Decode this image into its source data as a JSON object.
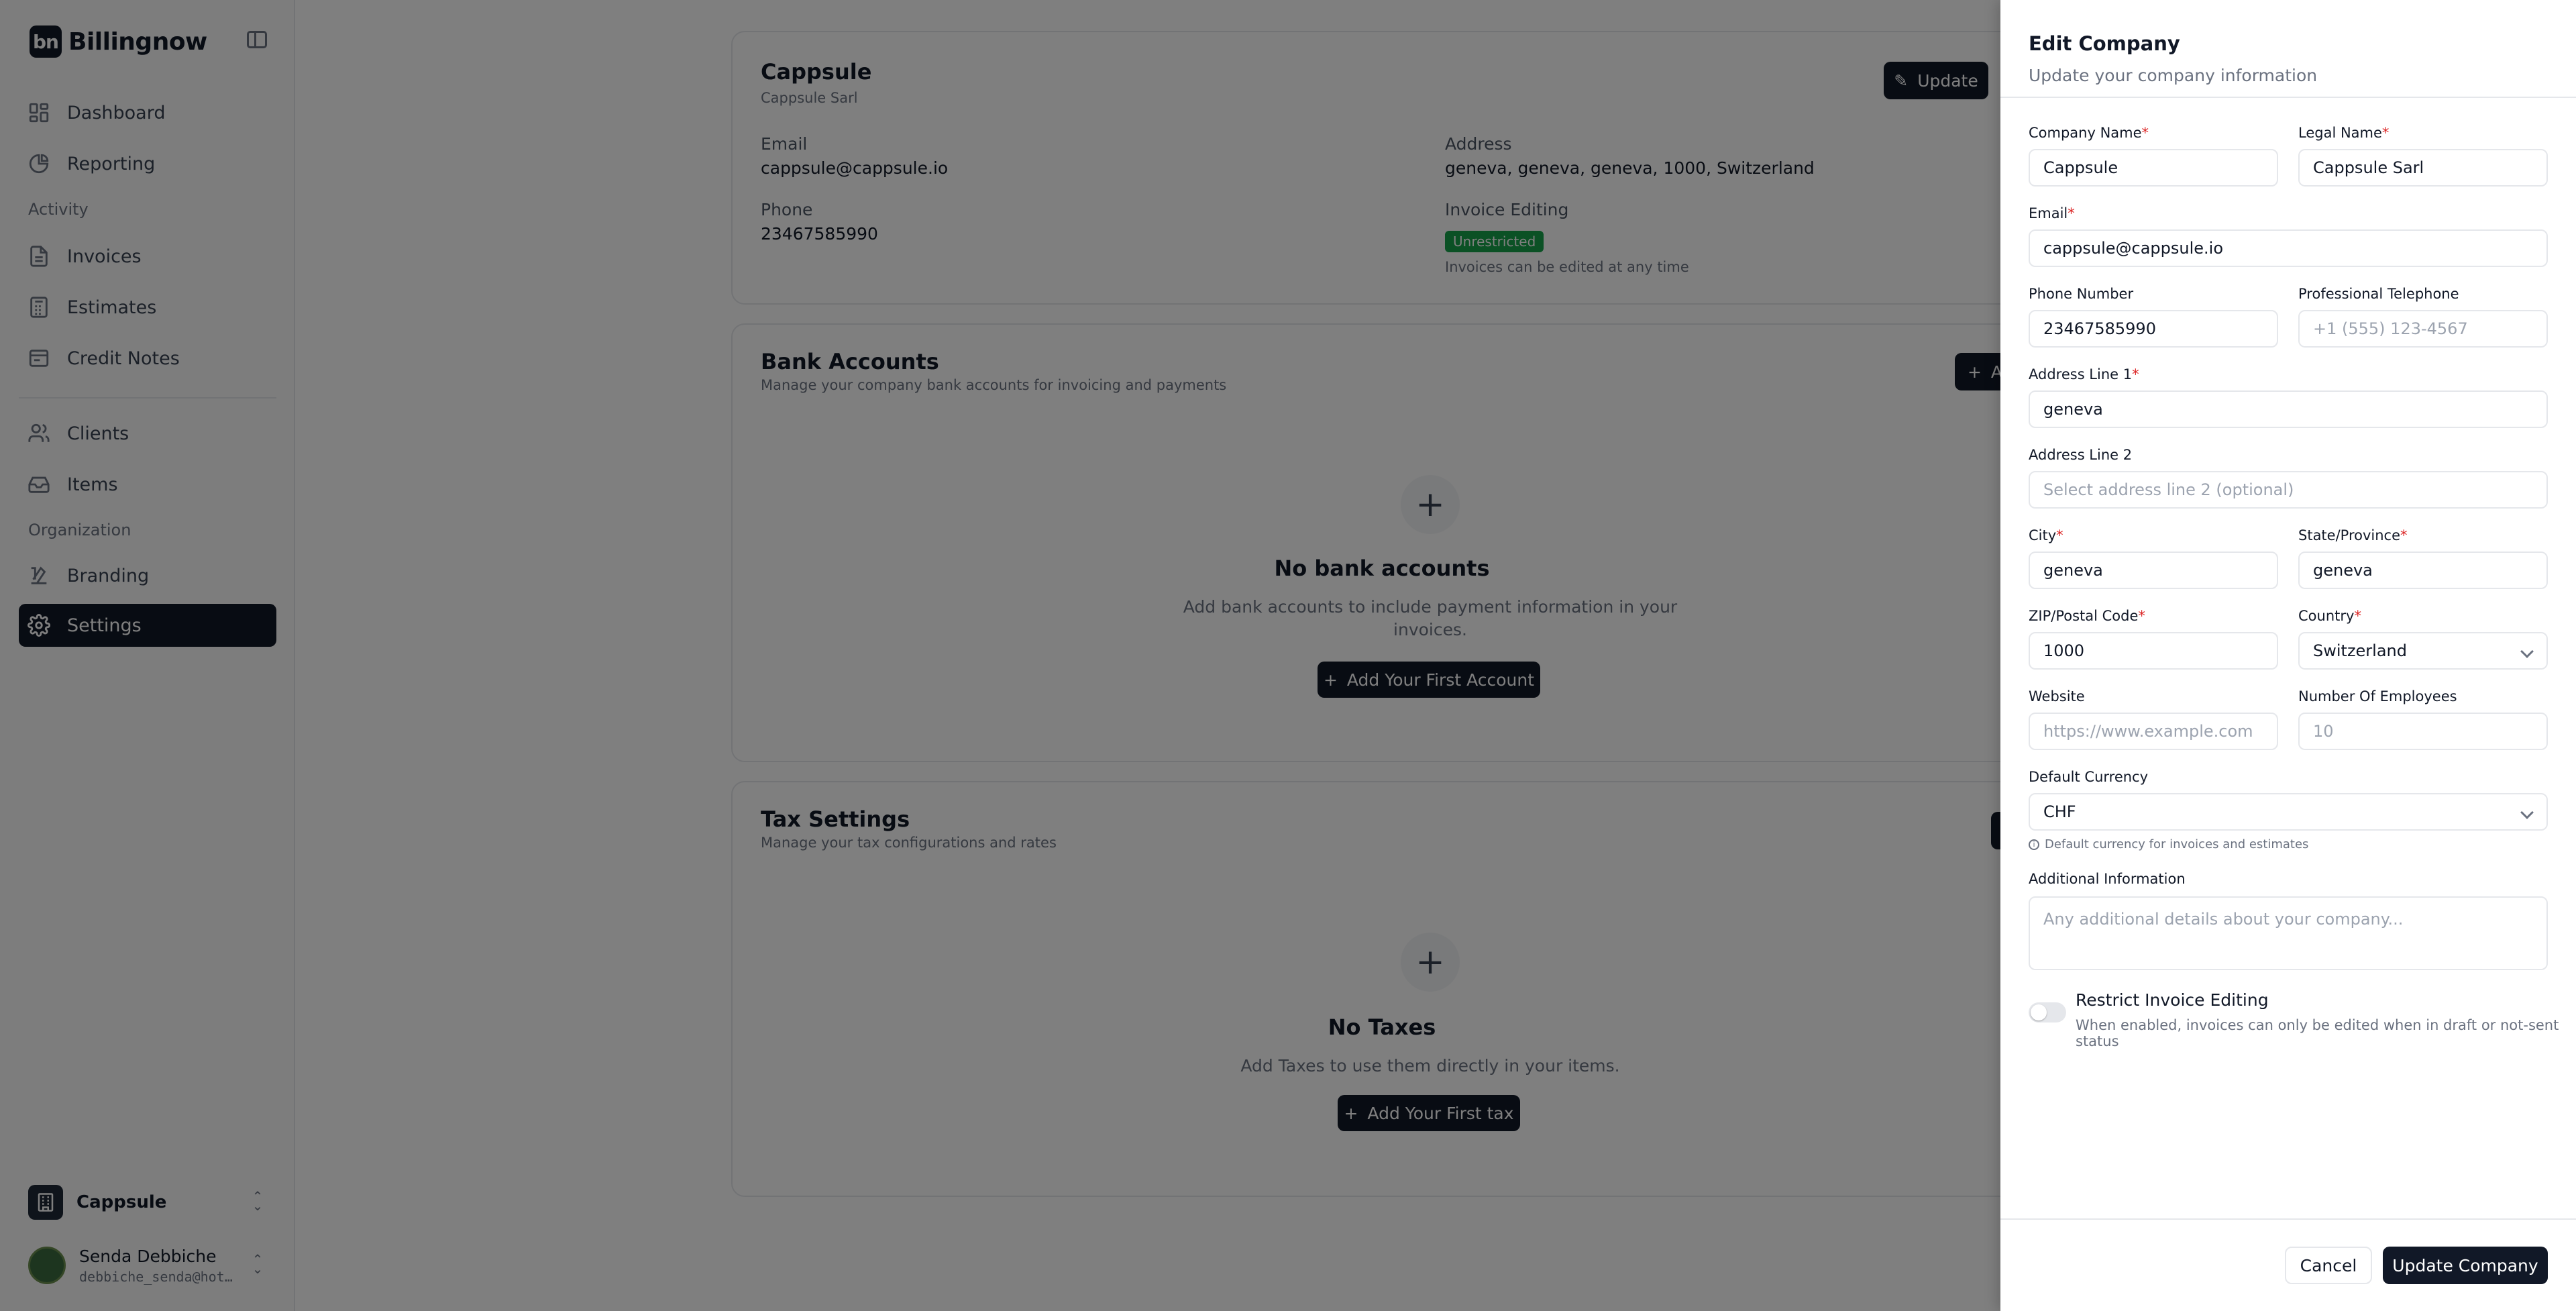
{
  "brand": {
    "name": "Billingnow",
    "mark": "bn"
  },
  "sidebar": {
    "items": [
      {
        "label": "Dashboard",
        "icon": "dashboard-icon"
      },
      {
        "label": "Reporting",
        "icon": "pie-chart-icon"
      },
      {
        "label": "Invoices",
        "icon": "file-icon"
      },
      {
        "label": "Estimates",
        "icon": "calculator-icon"
      },
      {
        "label": "Credit Notes",
        "icon": "receipt-icon"
      },
      {
        "label": "Clients",
        "icon": "users-icon"
      },
      {
        "label": "Items",
        "icon": "inbox-icon"
      },
      {
        "label": "Branding",
        "icon": "palette-icon"
      },
      {
        "label": "Settings",
        "icon": "gear-icon"
      }
    ],
    "sections": {
      "activity": "Activity",
      "organization": "Organization"
    },
    "org": {
      "name": "Cappsule"
    },
    "user": {
      "name": "Senda Debbiche",
      "email": "debbiche_senda@hot…"
    }
  },
  "company_card": {
    "title": "Cappsule",
    "subtitle": "Cappsule Sarl",
    "update_label": "Update",
    "email_label": "Email",
    "email_value": "cappsule@cappsule.io",
    "phone_label": "Phone",
    "phone_value": "23467585990",
    "address_label": "Address",
    "address_value": "geneva, geneva, geneva, 1000, Switzerland",
    "invoice_label": "Invoice Editing",
    "invoice_badge": "Unrestricted",
    "invoice_note": "Invoices can be edited at any time"
  },
  "bank_card": {
    "title": "Bank Accounts",
    "subtitle": "Manage your company bank accounts for invoicing and payments",
    "add_label": "A",
    "empty_title": "No bank accounts",
    "empty_desc_1": "Add bank accounts to include payment information in your",
    "empty_desc_2": "invoices.",
    "cta": "Add Your First Account"
  },
  "tax_card": {
    "title": "Tax Settings",
    "subtitle": "Manage your tax configurations and rates",
    "empty_title": "No Taxes",
    "empty_desc": "Add Taxes to use them directly in your items.",
    "cta": "Add Your First tax"
  },
  "drawer": {
    "title": "Edit Company",
    "subtitle": "Update your company information",
    "company_name": {
      "label": "Company Name",
      "value": "Cappsule"
    },
    "legal_name": {
      "label": "Legal Name",
      "value": "Cappsule Sarl"
    },
    "email": {
      "label": "Email",
      "value": "cappsule@cappsule.io"
    },
    "phone": {
      "label": "Phone Number",
      "value": "23467585990"
    },
    "pro_phone": {
      "label": "Professional Telephone",
      "placeholder": "+1 (555) 123-4567"
    },
    "address1": {
      "label": "Address Line 1",
      "value": "geneva"
    },
    "address2": {
      "label": "Address Line 2",
      "placeholder": "Select address line 2 (optional)"
    },
    "city": {
      "label": "City",
      "value": "geneva"
    },
    "state": {
      "label": "State/Province",
      "value": "geneva"
    },
    "zip": {
      "label": "ZIP/Postal Code",
      "value": "1000"
    },
    "country": {
      "label": "Country",
      "value": "Switzerland"
    },
    "website": {
      "label": "Website",
      "placeholder": "https://www.example.com"
    },
    "employees": {
      "label": "Number Of Employees",
      "placeholder": "10"
    },
    "currency": {
      "label": "Default Currency",
      "value": "CHF",
      "hint": "Default currency for invoices and estimates"
    },
    "additional": {
      "label": "Additional Information",
      "placeholder": "Any additional details about your company..."
    },
    "restrict": {
      "title": "Restrict Invoice Editing",
      "desc": "When enabled, invoices can only be edited when in draft or not-sent status",
      "enabled": false
    },
    "cancel_label": "Cancel",
    "submit_label": "Update Company"
  }
}
